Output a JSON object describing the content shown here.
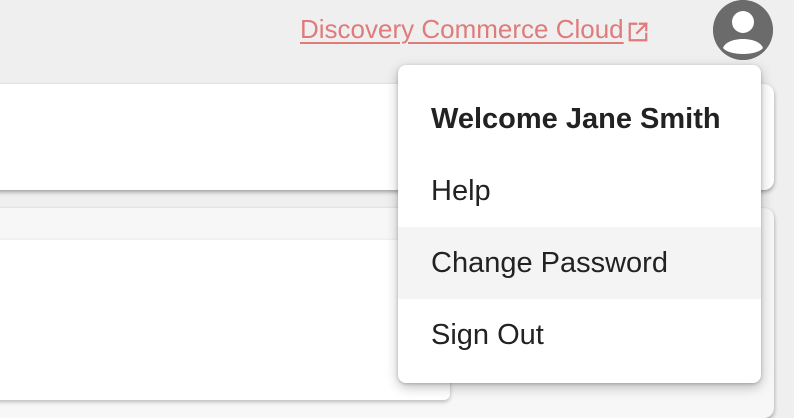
{
  "header": {
    "link_label": "Discovery Commerce Cloud",
    "link_icon": "external-link-icon",
    "avatar_icon": "user-avatar-icon"
  },
  "user_menu": {
    "welcome": "Welcome Jane Smith",
    "items": [
      {
        "label": "Help"
      },
      {
        "label": "Change Password",
        "state": "hovered"
      },
      {
        "label": "Sign Out"
      }
    ]
  },
  "colors": {
    "link": "#e07b7b",
    "avatar": "#6b6b6b",
    "background": "#efefef",
    "hover": "#f4f4f4"
  }
}
